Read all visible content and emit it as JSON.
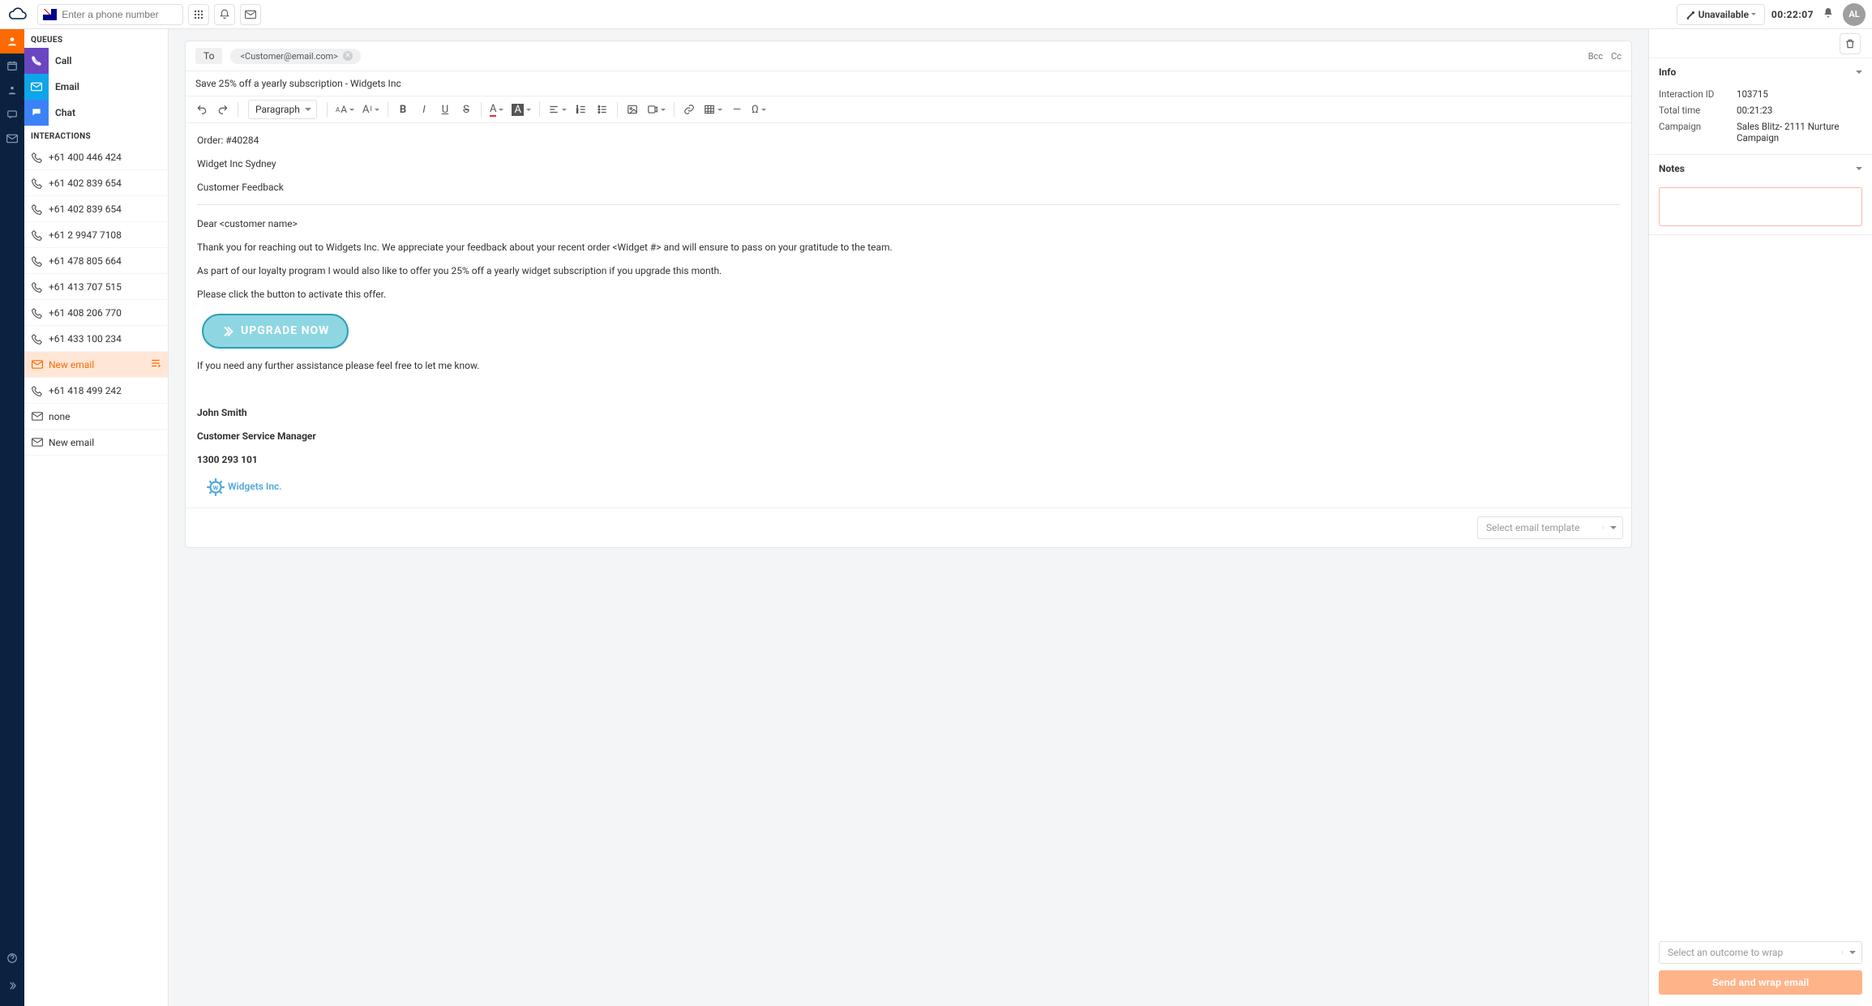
{
  "topbar": {
    "phone_placeholder": "Enter a phone number",
    "status_label": "Unavailable",
    "timer": "00:22:07",
    "avatar_initials": "AL"
  },
  "sidebar": {
    "queues_title": "QUEUES",
    "interactions_title": "INTERACTIONS",
    "queues": [
      {
        "label": "Call"
      },
      {
        "label": "Email"
      },
      {
        "label": "Chat"
      }
    ],
    "interactions": [
      {
        "type": "call",
        "label": "+61 400 446 424"
      },
      {
        "type": "call",
        "label": "+61 402 839 654"
      },
      {
        "type": "call",
        "label": "+61 402 839 654"
      },
      {
        "type": "call",
        "label": "+61 2 9947 7108"
      },
      {
        "type": "call",
        "label": "+61 478 805 664"
      },
      {
        "type": "call",
        "label": "+61 413 707 515"
      },
      {
        "type": "call",
        "label": "+61 408 206 770"
      },
      {
        "type": "call",
        "label": "+61 433 100 234"
      },
      {
        "type": "email",
        "label": "New email",
        "active": true
      },
      {
        "type": "call",
        "label": "+61 418 499 242"
      },
      {
        "type": "email",
        "label": "none"
      },
      {
        "type": "email",
        "label": "New email"
      }
    ]
  },
  "email": {
    "to_label": "To",
    "recipient_chip": "<Customer@email.com>",
    "bcc": "Bcc",
    "cc": "Cc",
    "subject": "Save 25% off a yearly subscription - Widgets Inc",
    "toolbar": {
      "paragraph": "Paragraph"
    },
    "body": {
      "line1": "Order: #40284",
      "line2": "Widget Inc Sydney",
      "line3": "Customer Feedback",
      "greeting": "Dear <customer name>",
      "p1": "Thank you for reaching out to Widgets Inc. We appreciate your feedback about your  recent order <Widget #> and will ensure to pass on your gratitude to the team.",
      "p2": "As part of our loyalty program I would also like to offer you 25% off a yearly widget subscription if you upgrade this month.",
      "p3": "Please click the button to activate this offer.",
      "cta": "UPGRADE NOW",
      "p4": "If you need any further assistance please feel free to let me know.",
      "sig_name": "John Smith",
      "sig_title": "Customer Service Manager",
      "sig_phone": "1300 293 101",
      "sig_company": "Widgets Inc."
    },
    "template_placeholder": "Select email template"
  },
  "rightpanel": {
    "info_title": "Info",
    "notes_title": "Notes",
    "info": {
      "interaction_id_k": "Interaction ID",
      "interaction_id_v": "103715",
      "total_time_k": "Total time",
      "total_time_v": "00:21:23",
      "campaign_k": "Campaign",
      "campaign_v": "Sales Blitz- 2111 Nurture Campaign"
    },
    "outcome_placeholder": "Select an outcome to wrap",
    "send_label": "Send and wrap email"
  }
}
